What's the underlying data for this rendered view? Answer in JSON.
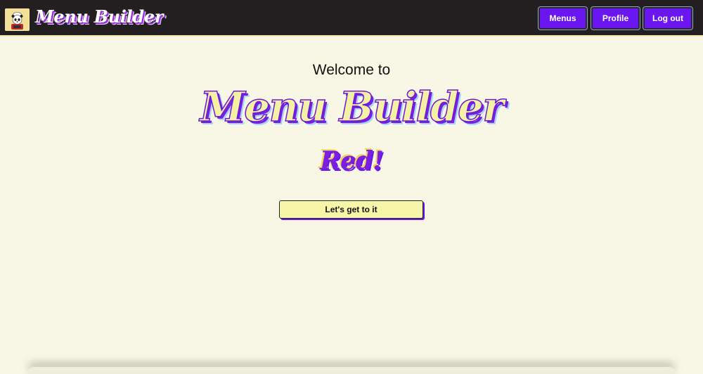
{
  "header": {
    "brand": "Menu Builder",
    "logo_icon": "panda-chef-icon",
    "nav": {
      "menus": "Menus",
      "profile": "Profile",
      "logout": "Log out"
    }
  },
  "main": {
    "welcome": "Welcome to",
    "title": "Menu Builder",
    "subtitle": "Red!",
    "cta_label": "Let's get to it"
  },
  "colors": {
    "navbar_bg": "#231f20",
    "page_bg": "#f8f7e6",
    "accent_purple": "#6a16f0",
    "accent_yellow": "#f6f5a8"
  }
}
